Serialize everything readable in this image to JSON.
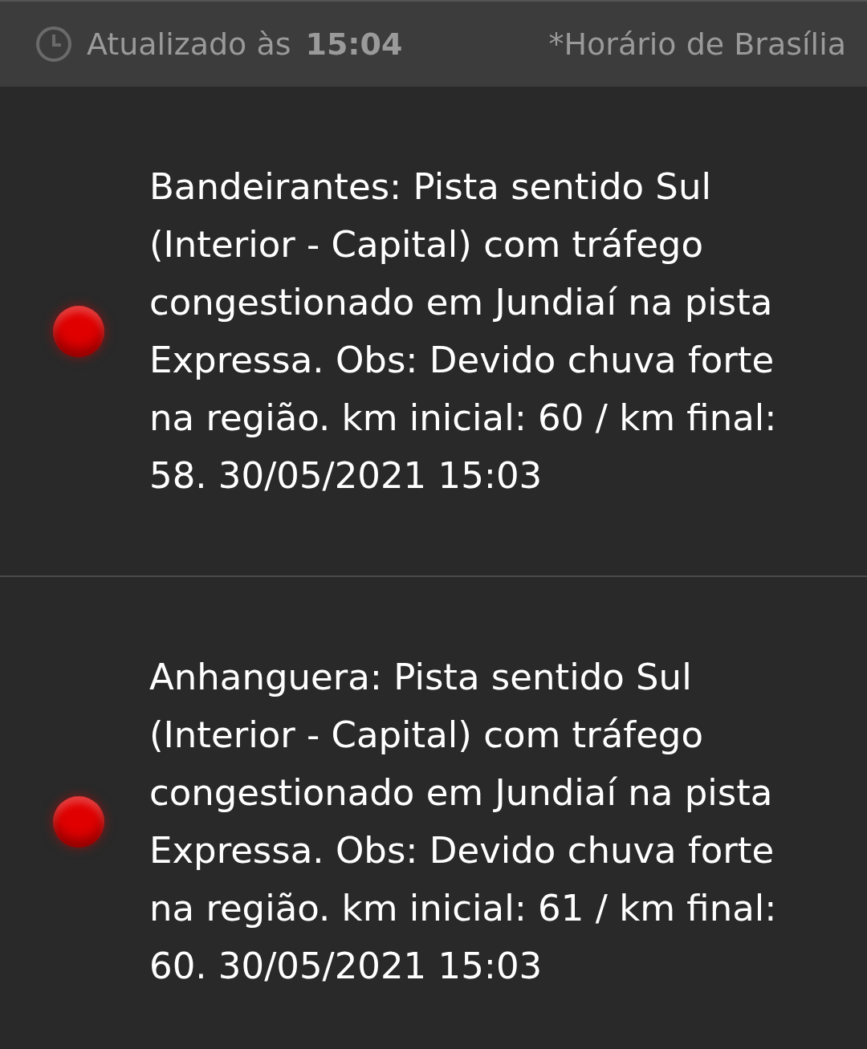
{
  "header": {
    "updated_label": "Atualizado às",
    "updated_time": "15:04",
    "timezone_note": "*Horário de Brasília"
  },
  "alerts": [
    {
      "color": "#e00000",
      "text": "Bandeirantes: Pista sentido Sul (Interior - Capital) com tráfego congestionado em Jundiaí na pista Expressa. Obs: Devido chuva forte na região. km inicial: 60 / km final: 58. 30/05/2021 15:03"
    },
    {
      "color": "#e00000",
      "text": "Anhanguera: Pista sentido Sul (Interior - Capital) com tráfego congestionado em Jundiaí na pista Expressa. Obs: Devido chuva forte na região. km inicial: 61 / km final: 60. 30/05/2021 15:03"
    }
  ]
}
